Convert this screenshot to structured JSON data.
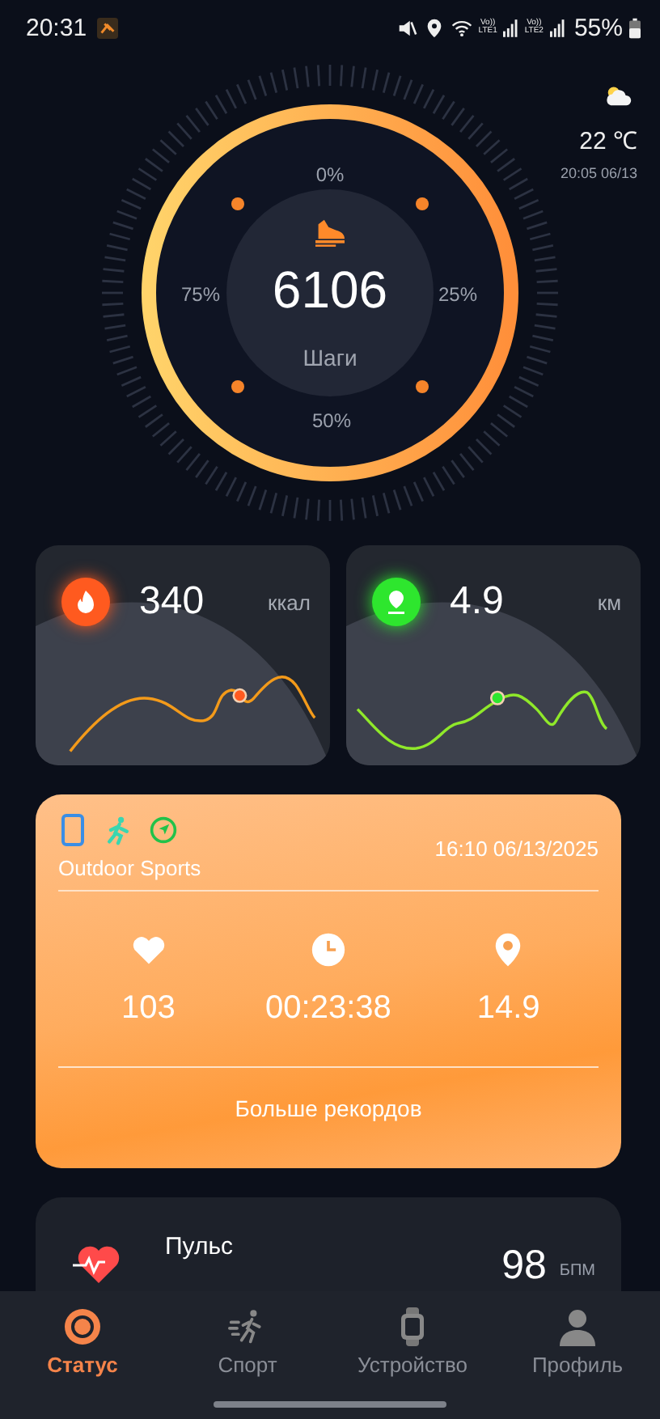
{
  "status_bar": {
    "time": "20:31",
    "sims": [
      {
        "top": "Vo))",
        "bottom": "LTE1"
      },
      {
        "top": "Vo))",
        "bottom": "LTE2"
      }
    ],
    "battery": "55%"
  },
  "weather": {
    "temperature": "22 ℃",
    "updated": "20:05 06/13"
  },
  "steps": {
    "value": "6106",
    "label": "Шаги",
    "marks": [
      "0%",
      "25%",
      "50%",
      "75%"
    ]
  },
  "metrics": [
    {
      "kind": "calories",
      "value": "340",
      "unit": "ккал",
      "color": "#ff5a1f"
    },
    {
      "kind": "distance",
      "value": "4.9",
      "unit": "км",
      "color": "#2ee62e"
    }
  ],
  "workout": {
    "title": "Outdoor Sports",
    "datetime": "16:10 06/13/2025",
    "stats": [
      {
        "kind": "heart",
        "value": "103"
      },
      {
        "kind": "time",
        "value": "00:23:38"
      },
      {
        "kind": "location",
        "value": "14.9"
      }
    ],
    "more": "Больше рекордов"
  },
  "pulse": {
    "label": "Пульс",
    "value": "98",
    "unit": "БПМ"
  },
  "nav": [
    {
      "kind": "status",
      "label": "Статус",
      "selected": true
    },
    {
      "kind": "sport",
      "label": "Спорт",
      "selected": false
    },
    {
      "kind": "device",
      "label": "Устройство",
      "selected": false
    },
    {
      "kind": "profile",
      "label": "Профиль",
      "selected": false
    }
  ]
}
